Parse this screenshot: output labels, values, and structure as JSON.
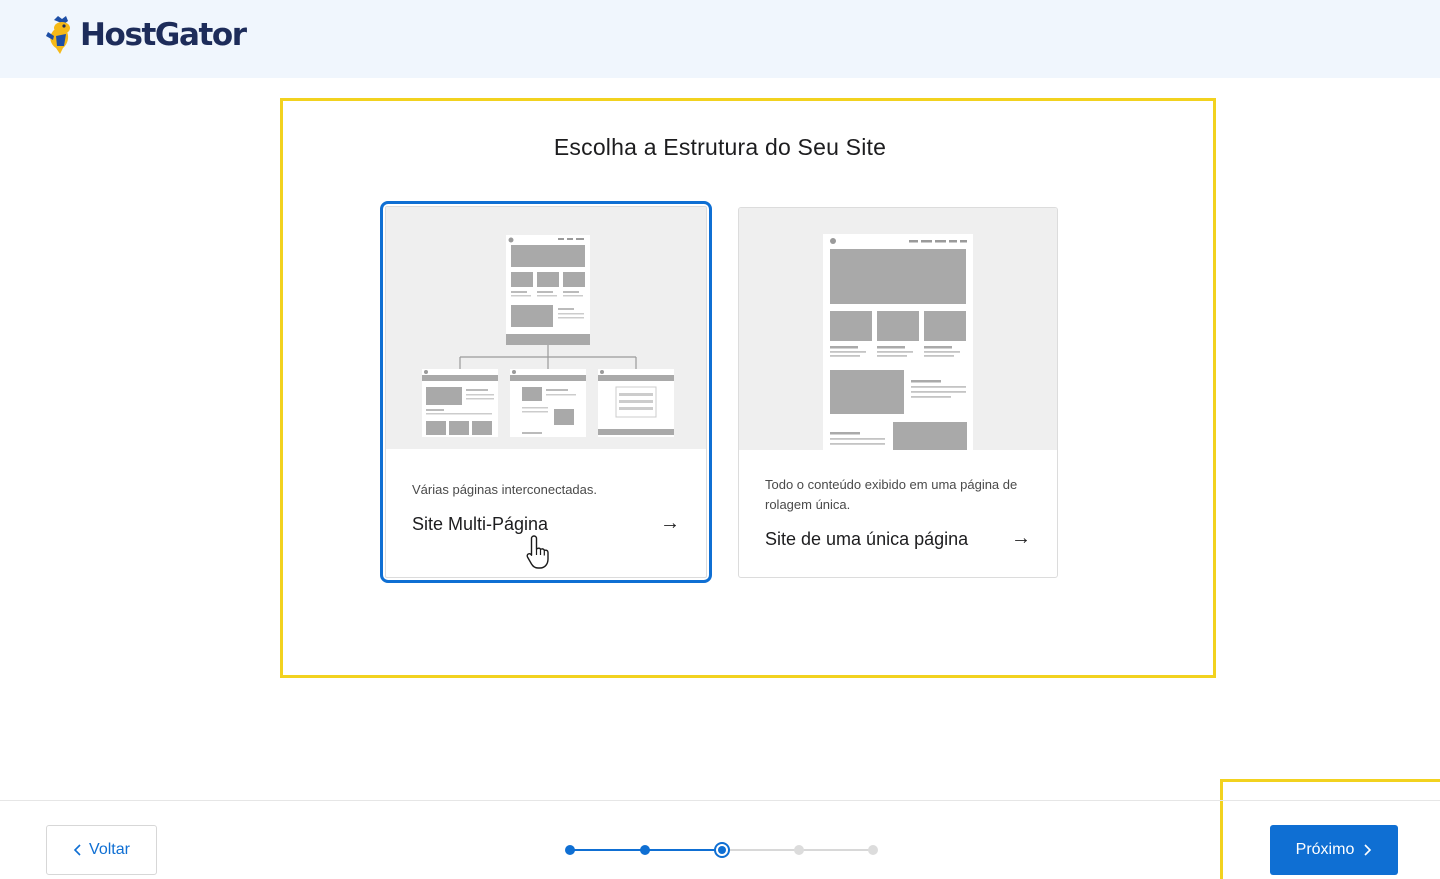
{
  "header": {
    "brand": "HostGator"
  },
  "main": {
    "title": "Escolha a Estrutura do Seu Site",
    "options": [
      {
        "id": "multi",
        "description": "Várias páginas interconectadas.",
        "label": "Site Multi-Página",
        "arrow": "→",
        "selected": true
      },
      {
        "id": "single",
        "description": "Todo o conteúdo exibido em uma página de rolagem única.",
        "label": "Site de uma única página",
        "arrow": "→",
        "selected": false
      }
    ]
  },
  "footer": {
    "back_label": "Voltar",
    "next_label": "Próximo",
    "steps": {
      "total": 5,
      "current": 3
    }
  },
  "colors": {
    "accent": "#0f6fd3",
    "highlight": "#f2d21f",
    "header_bg": "#f0f6fd",
    "brand_text": "#1d2c5a"
  },
  "icons": {
    "logo": "gator-mascot-icon",
    "back": "chevron-left-icon",
    "next": "chevron-right-icon",
    "option_arrow": "arrow-right-icon"
  }
}
